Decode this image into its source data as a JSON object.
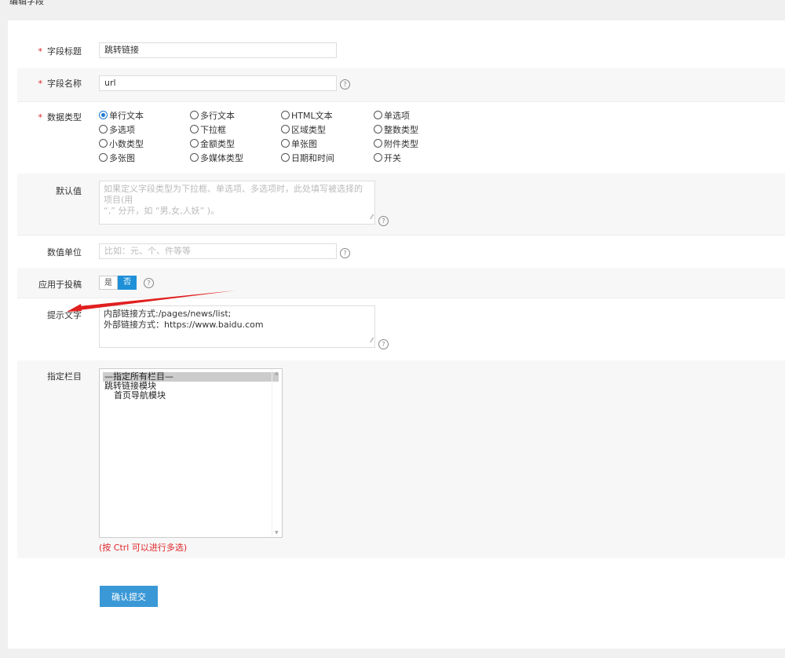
{
  "page": {
    "title": "编辑字段"
  },
  "form": {
    "field_title": {
      "label": "字段标题",
      "value": "跳转链接"
    },
    "field_name": {
      "label": "字段名称",
      "value": "url"
    },
    "data_type": {
      "label": "数据类型",
      "options": [
        "单行文本",
        "多行文本",
        "HTML文本",
        "单选项",
        "多选项",
        "下拉框",
        "区域类型",
        "整数类型",
        "小数类型",
        "金额类型",
        "单张图",
        "附件类型",
        "多张图",
        "多媒体类型",
        "日期和时间",
        "开关"
      ],
      "selected": "单行文本"
    },
    "default_value": {
      "label": "默认值",
      "placeholder_line1": "如果定义字段类型为下拉框、单选项、多选项时，此处填写被选择的项目(用",
      "placeholder_line2": "“,” 分开，如 “男,女,人妖” )。"
    },
    "unit": {
      "label": "数值单位",
      "placeholder": "比如：元、个、件等等"
    },
    "contribute": {
      "label": "应用于投稿",
      "yes": "是",
      "no": "否",
      "selected": "否"
    },
    "tip_text": {
      "label": "提示文字",
      "line1": "内部链接方式:/pages/news/list;",
      "line2": "外部链接方式：https://www.baidu.com"
    },
    "columns": {
      "label": "指定栏目",
      "options": [
        "—指定所有栏目—",
        "跳转链接模块",
        "首页导航模块"
      ],
      "selected": "—指定所有栏目—",
      "hint": "(按 Ctrl 可以进行多选)"
    },
    "submit_label": "确认提交",
    "required_mark": "*",
    "help_glyph": "?",
    "resize_glyph": "⁄⁄"
  },
  "colors": {
    "accent": "#1e90d8",
    "submit": "#3a98d6",
    "required": "#e02020",
    "arrow": "#e02020",
    "hint": "#e0262a"
  }
}
